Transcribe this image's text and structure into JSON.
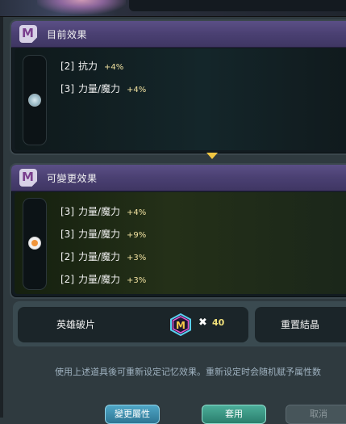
{
  "current_panel": {
    "title": "目前效果",
    "effects": [
      {
        "slot": "[2]",
        "name": "抗力",
        "value": "+4%"
      },
      {
        "slot": "[3]",
        "name": "力量/魔力",
        "value": "+4%"
      }
    ]
  },
  "new_panel": {
    "title": "可變更效果",
    "effects": [
      {
        "slot": "[3]",
        "name": "力量/魔力",
        "value": "+4%"
      },
      {
        "slot": "[3]",
        "name": "力量/魔力",
        "value": "+9%"
      },
      {
        "slot": "[2]",
        "name": "力量/魔力",
        "value": "+3%"
      },
      {
        "slot": "[2]",
        "name": "力量/魔力",
        "value": "+3%"
      }
    ]
  },
  "items": {
    "hero_shard_label": "英雄破片",
    "times_symbol": "✖",
    "hero_shard_count": "40",
    "reset_crystal_label": "重置結晶"
  },
  "info_text": "使用上述道具後可重新设定记忆效果。重新设定时会随机赋予属性数",
  "buttons": {
    "change": "變更屬性",
    "use": "套用",
    "cancel": "取消"
  },
  "icons": {
    "badge": "m-badge-icon",
    "gem": "m-gem-icon",
    "arrow": "down-arrow-icon"
  }
}
